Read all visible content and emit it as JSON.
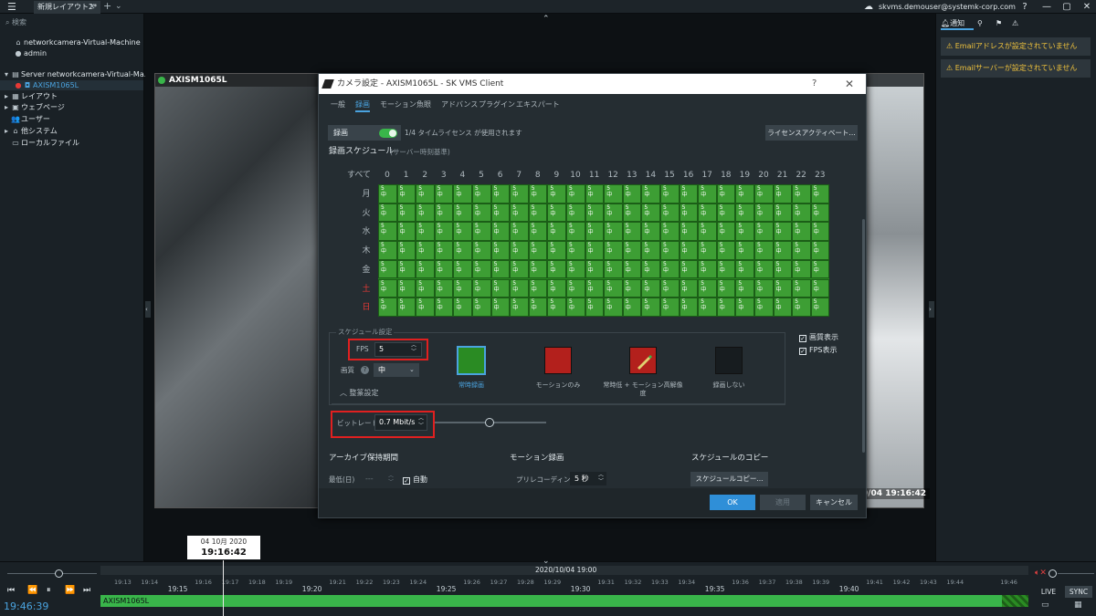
{
  "titlebar": {
    "tab_label": "新規レイアウト2*",
    "user_email": "skvms.demouser@systemk-corp.com",
    "help": "?",
    "minimize": "—",
    "maximize": "▢",
    "close": "✕"
  },
  "leftpanel": {
    "search_placeholder": "検索",
    "items": [
      {
        "label": "networkcamera-Virtual-Machine",
        "icon": "home-icon"
      },
      {
        "label": "admin",
        "icon": "user-icon"
      },
      {
        "label": "Server networkcamera-Virtual-Ma...",
        "icon": "server-icon"
      },
      {
        "label": "AXISM1065L",
        "icon": "camera-icon"
      },
      {
        "label": "レイアウト",
        "icon": "layout-icon"
      },
      {
        "label": "ウェブページ",
        "icon": "webpage-icon"
      },
      {
        "label": "ユーザー",
        "icon": "users-icon"
      },
      {
        "label": "他システム",
        "icon": "other-systems-icon"
      },
      {
        "label": "ローカルファイル",
        "icon": "folder-icon"
      }
    ]
  },
  "camera": {
    "title": "AXISM1065L",
    "timestamp": "0/04 19:16:42"
  },
  "rightpanel": {
    "tab_notifications": "通知",
    "notifications": [
      "Emailアドレスが設定されていません",
      "Emailサーバーが設定されていません"
    ]
  },
  "dialog": {
    "title": "カメラ設定 - AXISM1065L - SK VMS Client",
    "tabs": [
      "一般",
      "録画",
      "モーション",
      "魚眼",
      "アドバンス",
      "プラグイン",
      "エキスパート"
    ],
    "active_tab": "録画",
    "record_label": "録画",
    "license_text": "1/4 タイムライセンス が使用されます",
    "license_button": "ライセンスアクティベート...",
    "schedule_title": "録画スケジュール",
    "schedule_subtitle": "(サーバー時刻基準)",
    "all_label": "すべて",
    "hours": [
      "0",
      "1",
      "2",
      "3",
      "4",
      "5",
      "6",
      "7",
      "8",
      "9",
      "10",
      "11",
      "12",
      "13",
      "14",
      "15",
      "16",
      "17",
      "18",
      "19",
      "20",
      "21",
      "22",
      "23"
    ],
    "days": [
      {
        "label": "月",
        "color": "#aeb8be"
      },
      {
        "label": "火",
        "color": "#aeb8be"
      },
      {
        "label": "水",
        "color": "#aeb8be"
      },
      {
        "label": "木",
        "color": "#aeb8be"
      },
      {
        "label": "金",
        "color": "#aeb8be"
      },
      {
        "label": "土",
        "color": "#e53935"
      },
      {
        "label": "日",
        "color": "#e53935"
      }
    ],
    "cell_fps": "5",
    "cell_quality": "中",
    "schedule_settings_title": "スケジュール設定",
    "fps_label": "FPS",
    "fps_value": "5",
    "quality_label": "画質",
    "quality_value": "中",
    "advanced_label": "整篆設定",
    "rec_types": [
      {
        "label": "常時録画",
        "color": "#2a8b23"
      },
      {
        "label": "モーションのみ",
        "color": "#b3201c"
      },
      {
        "label": "常時低 + モーション高解像度",
        "color": "#b3201c"
      },
      {
        "label": "録画しない",
        "color": "#171c1f"
      }
    ],
    "show_quality": "画質表示",
    "show_fps": "FPS表示",
    "bitrate_label": "ビットレート",
    "bitrate_value": "0.7 Mbit/s",
    "bitrate_slider_fraction": 0.49,
    "archive_title": "アーカイブ保持期間",
    "motion_title": "モーション録画",
    "copy_title": "スケジュールのコピー",
    "min_label": "最低(日)",
    "min_value": "---",
    "auto_label": "自動",
    "prerec_label": "プリレコーディング",
    "prerec_value": "5 秒",
    "copy_button": "スケジュールコピー...",
    "ok": "OK",
    "apply": "適用",
    "cancel": "キャンセル"
  },
  "timeline": {
    "tooltip_date": "04 10月 2020",
    "tooltip_time": "19:16:42",
    "date_label": "2020/10/04 19:00",
    "clock": "19:46:39",
    "camera_label": "AXISM1065L",
    "minor_ticks": [
      "19:13",
      "19:14",
      "19:16",
      "19:17",
      "19:18",
      "19:19",
      "19:21",
      "19:22",
      "19:23",
      "19:24",
      "19:26",
      "19:27",
      "19:28",
      "19:29",
      "19:31",
      "19:32",
      "19:33",
      "19:34",
      "19:36",
      "19:37",
      "19:38",
      "19:39",
      "19:41",
      "19:42",
      "19:43",
      "19:44",
      "19:46"
    ],
    "major_ticks": [
      "19:15",
      "19:20",
      "19:25",
      "19:30",
      "19:35",
      "19:40"
    ],
    "live": "LIVE",
    "sync": "SYNC"
  }
}
